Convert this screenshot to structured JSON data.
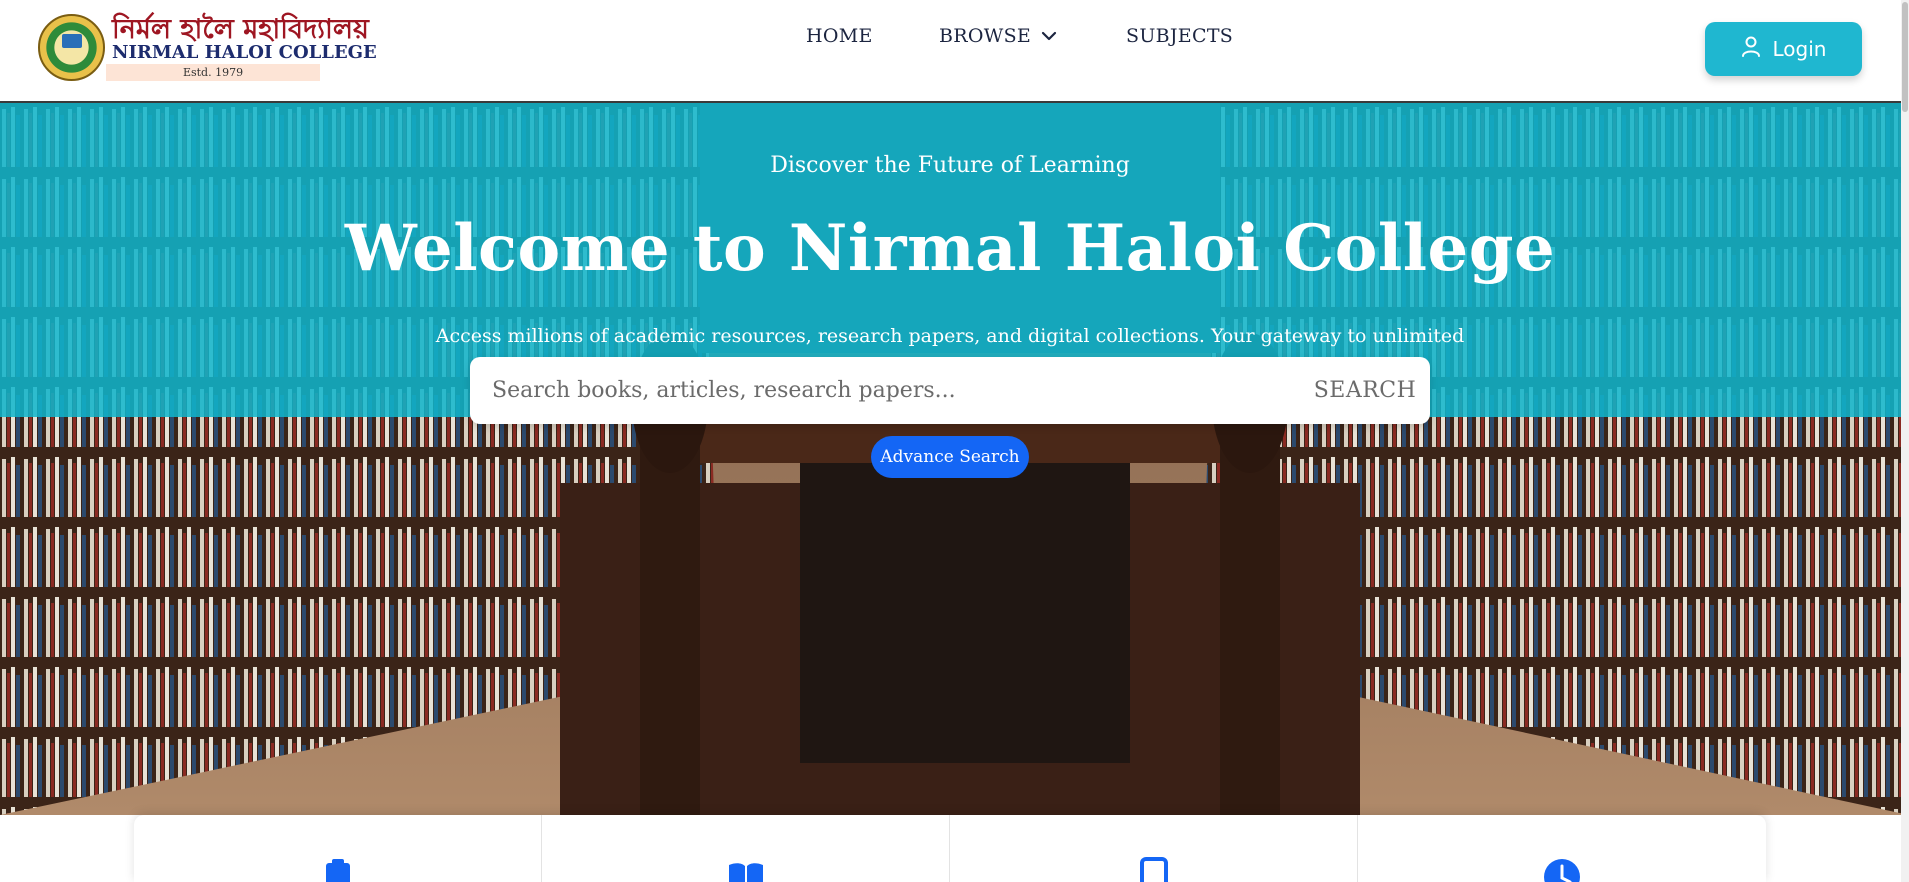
{
  "logo": {
    "bengali_name": "নির্মল হালৈ মহাবিদ্যালয়",
    "english_name": "NIRMAL HALOI COLLEGE",
    "established": "Estd. 1979"
  },
  "nav": {
    "items": [
      {
        "label": "HOME"
      },
      {
        "label": "BROWSE"
      },
      {
        "label": "SUBJECTS"
      }
    ]
  },
  "header": {
    "login_label": "Login"
  },
  "hero": {
    "tagline": "Discover the Future of Learning",
    "title": "Welcome to Nirmal Haloi College",
    "description": "Access millions of academic resources, research papers, and digital collections. Your gateway to unlimited",
    "search_placeholder": "Search books, articles, research papers...",
    "search_button": "SEARCH",
    "advance_search": "Advance Search"
  },
  "features": [
    {
      "icon": "clipboard-icon"
    },
    {
      "icon": "book-open-icon"
    },
    {
      "icon": "tablet-icon"
    },
    {
      "icon": "clock-icon"
    }
  ],
  "colors": {
    "accent": "#1fb7d0",
    "hero_overlay": "#0fb6cd",
    "primary_button": "#1466f5",
    "nav_text": "#1c2540",
    "icon_blue": "#1466f5"
  }
}
